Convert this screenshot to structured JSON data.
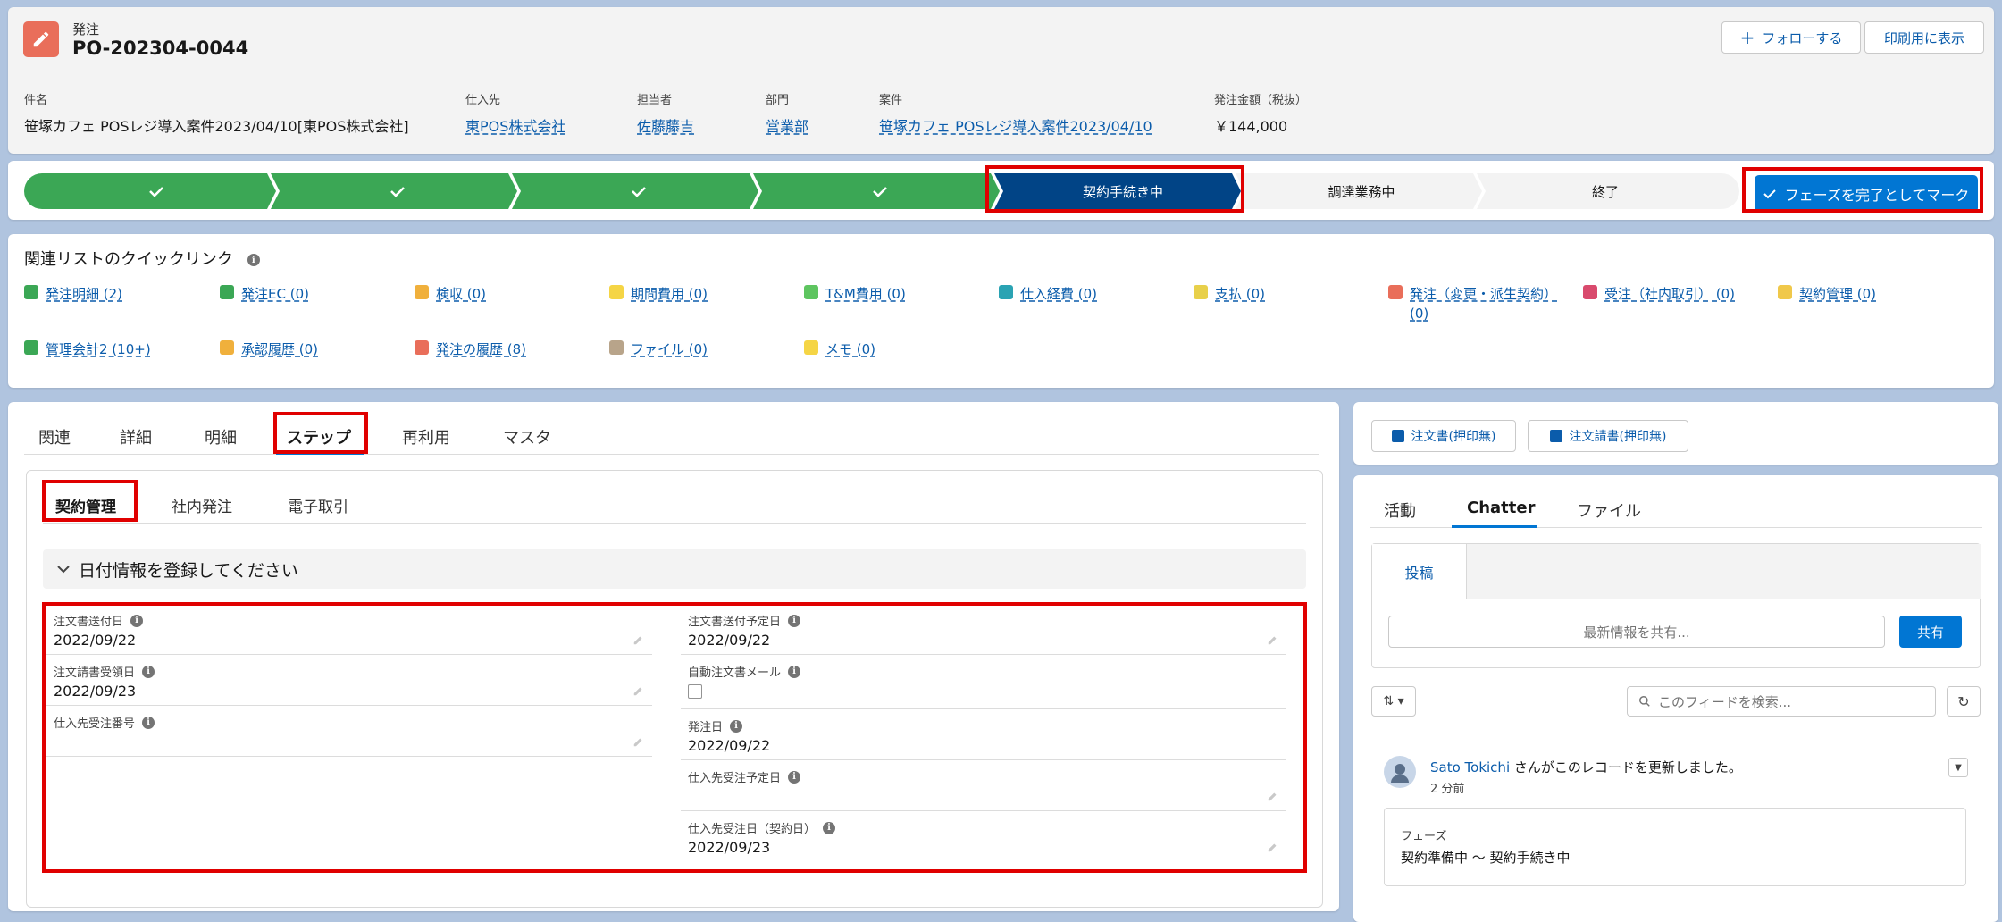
{
  "header": {
    "object_type": "発注",
    "record_name": "PO-202304-0044",
    "follow_label": "フォローする",
    "print_label": "印刷用に表示",
    "fields": [
      {
        "label": "件名",
        "value": "笹塚カフェ POSレジ導入案件2023/04/10[東POS株式会社]",
        "link": false
      },
      {
        "label": "仕入先",
        "value": "東POS株式会社",
        "link": true
      },
      {
        "label": "担当者",
        "value": "佐藤藤吉",
        "link": true
      },
      {
        "label": "部門",
        "value": "営業部",
        "link": true
      },
      {
        "label": "案件",
        "value": "笹塚カフェ POSレジ導入案件2023/04/10",
        "link": true
      },
      {
        "label": "発注金額（税抜）",
        "value": "￥144,000",
        "link": false
      }
    ]
  },
  "path": {
    "stages": [
      {
        "label": "",
        "state": "complete"
      },
      {
        "label": "",
        "state": "complete"
      },
      {
        "label": "",
        "state": "complete"
      },
      {
        "label": "",
        "state": "complete"
      },
      {
        "label": "契約手続き中",
        "state": "current"
      },
      {
        "label": "調達業務中",
        "state": "incomplete"
      },
      {
        "label": "終了",
        "state": "incomplete"
      }
    ],
    "mark_complete_label": "フェーズを完了としてマーク"
  },
  "quick_links": {
    "title": "関連リストのクイックリンク",
    "items": [
      {
        "label": "発注明細 (2)",
        "color": "#3ba755"
      },
      {
        "label": "発注EC (0)",
        "color": "#3ba755"
      },
      {
        "label": "検収 (0)",
        "color": "#f0b03c"
      },
      {
        "label": "期間費用 (0)",
        "color": "#f5d545"
      },
      {
        "label": "T&M費用 (0)",
        "color": "#5ec560"
      },
      {
        "label": "仕入経費 (0)",
        "color": "#2aa3b3"
      },
      {
        "label": "支払 (0)",
        "color": "#e8d04a"
      },
      {
        "label": "発注（変更・派生契約） (0)",
        "color": "#e96e5a"
      },
      {
        "label": "受注（社内取引） (0)",
        "color": "#d94a6d"
      },
      {
        "label": "契約管理 (0)",
        "color": "#f0c84a"
      },
      {
        "label": "管理会計2 (10+)",
        "color": "#3ba755"
      },
      {
        "label": "承認履歴 (0)",
        "color": "#f0b03c"
      },
      {
        "label": "発注の履歴 (8)",
        "color": "#e96e5a"
      },
      {
        "label": "ファイル (0)",
        "color": "#b8a48a"
      },
      {
        "label": "メモ (0)",
        "color": "#f5d545"
      }
    ]
  },
  "main": {
    "tabs": [
      "関連",
      "詳細",
      "明細",
      "ステップ",
      "再利用",
      "マスタ"
    ],
    "subtabs": [
      "契約管理",
      "社内発注",
      "電子取引"
    ],
    "section_title": "日付情報を登録してください",
    "fields_left": [
      {
        "label": "注文書送付日",
        "value": "2022/09/22"
      },
      {
        "label": "注文請書受領日",
        "value": "2022/09/23"
      },
      {
        "label": "仕入先受注番号",
        "value": ""
      }
    ],
    "fields_right": [
      {
        "label": "注文書送付予定日",
        "value": "2022/09/22"
      },
      {
        "label": "自動注文書メール",
        "value": ""
      },
      {
        "label": "発注日",
        "value": "2022/09/22"
      },
      {
        "label": "仕入先受注予定日",
        "value": ""
      },
      {
        "label": "仕入先受注日（契約日）",
        "value": "2022/09/23"
      }
    ]
  },
  "right": {
    "buttons": [
      "注文書(押印無)",
      "注文請書(押印無)"
    ],
    "tabs": [
      "活動",
      "Chatter",
      "ファイル"
    ],
    "post_tab": "投稿",
    "share_placeholder": "最新情報を共有...",
    "share_button": "共有",
    "search_placeholder": "このフィードを検索...",
    "feed": {
      "user": "Sato Tokichi",
      "action": "さんがこのレコードを更新しました。",
      "time": "2 分前",
      "field_label": "フェーズ",
      "change": "契約準備中 ～ 契約手続き中"
    }
  }
}
